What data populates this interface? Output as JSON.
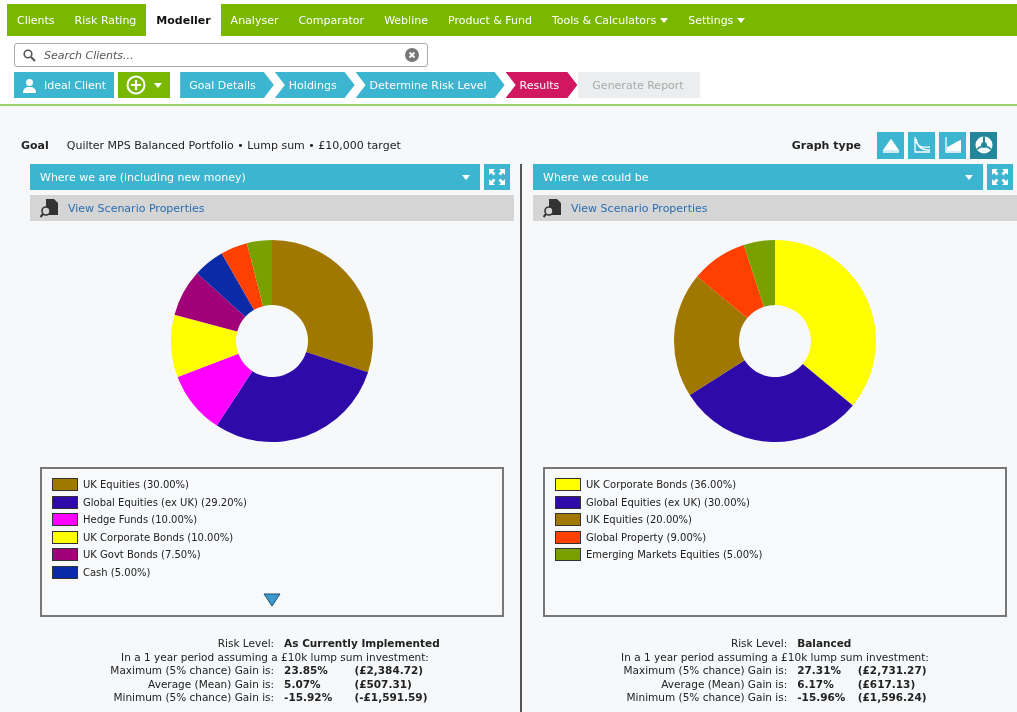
{
  "nav": [
    {
      "label": "Clients",
      "selected": false,
      "menu": false
    },
    {
      "label": "Risk Rating",
      "selected": false,
      "menu": false
    },
    {
      "label": "Modeller",
      "selected": true,
      "menu": false
    },
    {
      "label": "Analyser",
      "selected": false,
      "menu": false
    },
    {
      "label": "Comparator",
      "selected": false,
      "menu": false
    },
    {
      "label": "Webline",
      "selected": false,
      "menu": false
    },
    {
      "label": "Product & Fund",
      "selected": false,
      "menu": false
    },
    {
      "label": "Tools & Calculators",
      "selected": false,
      "menu": true
    },
    {
      "label": "Settings",
      "selected": false,
      "menu": true
    }
  ],
  "search": {
    "placeholder": "Search Clients..."
  },
  "client_button": "Ideal Client",
  "steps": [
    {
      "label": "Goal Details",
      "selected": false,
      "disabled": false
    },
    {
      "label": "Holdings",
      "selected": false,
      "disabled": false
    },
    {
      "label": "Determine Risk Level",
      "selected": false,
      "disabled": false
    },
    {
      "label": "Results",
      "selected": true,
      "disabled": false
    },
    {
      "label": "Generate Report",
      "selected": false,
      "disabled": true
    }
  ],
  "goal": {
    "label": "Goal",
    "value": "Quilter MPS Balanced Portfolio • Lump sum • £10,000 target"
  },
  "graph_type": {
    "label": "Graph type",
    "options": [
      {
        "kind": "mountain",
        "selected": false
      },
      {
        "kind": "curves",
        "selected": false
      },
      {
        "kind": "area",
        "selected": false
      },
      {
        "kind": "pie",
        "selected": true
      }
    ]
  },
  "panels": [
    {
      "scenario": "Where we are (including new money)",
      "properties_link": "View Scenario Properties",
      "chart_data": {
        "type": "donut",
        "values": [
          30,
          29.2,
          10,
          10,
          7.5,
          5,
          4.3,
          4
        ],
        "colors": [
          "#a07800",
          "#2e0aa8",
          "#ff00ff",
          "#ffff00",
          "#a00078",
          "#0a2aa8",
          "#ff4000",
          "#7aa000"
        ]
      },
      "legend": [
        {
          "label": "UK Equities (30.00%)",
          "color": "#a07800"
        },
        {
          "label": "Global Equities (ex UK) (29.20%)",
          "color": "#2e0aa8"
        },
        {
          "label": "Hedge Funds (10.00%)",
          "color": "#ff00ff"
        },
        {
          "label": "UK Corporate Bonds (10.00%)",
          "color": "#ffff00"
        },
        {
          "label": "UK Govt Bonds (7.50%)",
          "color": "#a00078"
        },
        {
          "label": "Cash (5.00%)",
          "color": "#0a2aa8"
        }
      ],
      "more": true,
      "risk_label": "Risk Level:",
      "risk_value": "As Currently Implemented",
      "period": "In a 1 year period assuming a £10k lump sum investment:",
      "stats": [
        {
          "label": "Maximum (5% chance) Gain is:",
          "percent": "23.85%",
          "amount": "(£2,384.72)"
        },
        {
          "label": "Average (Mean) Gain is:",
          "percent": "5.07%",
          "amount": "(£507.31)"
        },
        {
          "label": "Minimum (5% chance) Gain is:",
          "percent": "-15.92%",
          "amount": "(-£1,591.59)"
        }
      ]
    },
    {
      "scenario": "Where we could be",
      "properties_link": "View Scenario Properties",
      "chart_data": {
        "type": "donut",
        "values": [
          36,
          30,
          20,
          9,
          5
        ],
        "colors": [
          "#ffff00",
          "#2e0aa8",
          "#a07800",
          "#ff4000",
          "#7aa000"
        ]
      },
      "legend": [
        {
          "label": "UK Corporate Bonds (36.00%)",
          "color": "#ffff00"
        },
        {
          "label": "Global Equities (ex UK) (30.00%)",
          "color": "#2e0aa8"
        },
        {
          "label": "UK Equities (20.00%)",
          "color": "#a07800"
        },
        {
          "label": "Global Property (9.00%)",
          "color": "#ff4000"
        },
        {
          "label": "Emerging Markets Equities (5.00%)",
          "color": "#7aa000"
        }
      ],
      "more": false,
      "risk_label": "Risk Level:",
      "risk_value": "Balanced",
      "period": "In a 1 year period assuming a £10k lump sum investment:",
      "stats": [
        {
          "label": "Maximum (5% chance) Gain is:",
          "percent": "27.31%",
          "amount": "(£2,731.27)"
        },
        {
          "label": "Average (Mean) Gain is:",
          "percent": "6.17%",
          "amount": "(£617.13)"
        },
        {
          "label": "Minimum (5% chance) Gain is:",
          "percent": "-15.96%",
          "amount": "(£1,596.24)"
        }
      ]
    }
  ]
}
